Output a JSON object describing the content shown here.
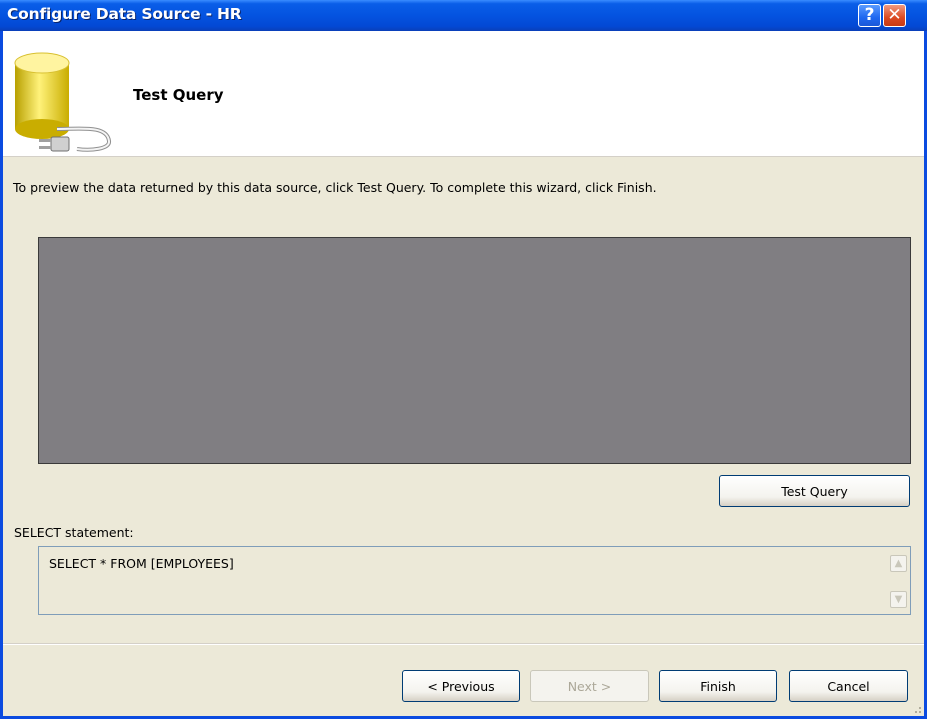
{
  "window": {
    "title": "Configure Data Source - HR",
    "help_label": "?",
    "close_label": "✕"
  },
  "header": {
    "title": "Test Query",
    "icon": "database-plug-icon"
  },
  "instructions": "To preview the data returned by this data source, click Test Query. To complete this wizard, click Finish.",
  "test_query_button": "Test Query",
  "select_section": {
    "label": "SELECT statement:",
    "statement": "SELECT * FROM [EMPLOYEES]"
  },
  "footer": {
    "previous": "< Previous",
    "next": "Next >",
    "finish": "Finish",
    "cancel": "Cancel"
  },
  "colors": {
    "titlebar": "#0453e0",
    "dialog_bg": "#ece9d8",
    "preview_bg": "#807e82"
  }
}
